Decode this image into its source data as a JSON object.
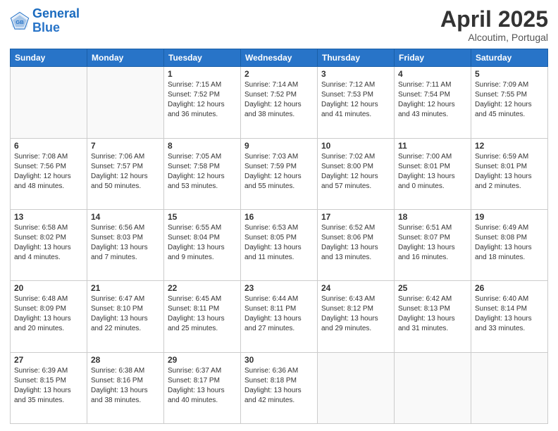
{
  "header": {
    "logo_line1": "General",
    "logo_line2": "Blue",
    "title": "April 2025",
    "subtitle": "Alcoutim, Portugal"
  },
  "days_of_week": [
    "Sunday",
    "Monday",
    "Tuesday",
    "Wednesday",
    "Thursday",
    "Friday",
    "Saturday"
  ],
  "weeks": [
    [
      {
        "day": "",
        "info": ""
      },
      {
        "day": "",
        "info": ""
      },
      {
        "day": "1",
        "info": "Sunrise: 7:15 AM\nSunset: 7:52 PM\nDaylight: 12 hours and 36 minutes."
      },
      {
        "day": "2",
        "info": "Sunrise: 7:14 AM\nSunset: 7:52 PM\nDaylight: 12 hours and 38 minutes."
      },
      {
        "day": "3",
        "info": "Sunrise: 7:12 AM\nSunset: 7:53 PM\nDaylight: 12 hours and 41 minutes."
      },
      {
        "day": "4",
        "info": "Sunrise: 7:11 AM\nSunset: 7:54 PM\nDaylight: 12 hours and 43 minutes."
      },
      {
        "day": "5",
        "info": "Sunrise: 7:09 AM\nSunset: 7:55 PM\nDaylight: 12 hours and 45 minutes."
      }
    ],
    [
      {
        "day": "6",
        "info": "Sunrise: 7:08 AM\nSunset: 7:56 PM\nDaylight: 12 hours and 48 minutes."
      },
      {
        "day": "7",
        "info": "Sunrise: 7:06 AM\nSunset: 7:57 PM\nDaylight: 12 hours and 50 minutes."
      },
      {
        "day": "8",
        "info": "Sunrise: 7:05 AM\nSunset: 7:58 PM\nDaylight: 12 hours and 53 minutes."
      },
      {
        "day": "9",
        "info": "Sunrise: 7:03 AM\nSunset: 7:59 PM\nDaylight: 12 hours and 55 minutes."
      },
      {
        "day": "10",
        "info": "Sunrise: 7:02 AM\nSunset: 8:00 PM\nDaylight: 12 hours and 57 minutes."
      },
      {
        "day": "11",
        "info": "Sunrise: 7:00 AM\nSunset: 8:01 PM\nDaylight: 13 hours and 0 minutes."
      },
      {
        "day": "12",
        "info": "Sunrise: 6:59 AM\nSunset: 8:01 PM\nDaylight: 13 hours and 2 minutes."
      }
    ],
    [
      {
        "day": "13",
        "info": "Sunrise: 6:58 AM\nSunset: 8:02 PM\nDaylight: 13 hours and 4 minutes."
      },
      {
        "day": "14",
        "info": "Sunrise: 6:56 AM\nSunset: 8:03 PM\nDaylight: 13 hours and 7 minutes."
      },
      {
        "day": "15",
        "info": "Sunrise: 6:55 AM\nSunset: 8:04 PM\nDaylight: 13 hours and 9 minutes."
      },
      {
        "day": "16",
        "info": "Sunrise: 6:53 AM\nSunset: 8:05 PM\nDaylight: 13 hours and 11 minutes."
      },
      {
        "day": "17",
        "info": "Sunrise: 6:52 AM\nSunset: 8:06 PM\nDaylight: 13 hours and 13 minutes."
      },
      {
        "day": "18",
        "info": "Sunrise: 6:51 AM\nSunset: 8:07 PM\nDaylight: 13 hours and 16 minutes."
      },
      {
        "day": "19",
        "info": "Sunrise: 6:49 AM\nSunset: 8:08 PM\nDaylight: 13 hours and 18 minutes."
      }
    ],
    [
      {
        "day": "20",
        "info": "Sunrise: 6:48 AM\nSunset: 8:09 PM\nDaylight: 13 hours and 20 minutes."
      },
      {
        "day": "21",
        "info": "Sunrise: 6:47 AM\nSunset: 8:10 PM\nDaylight: 13 hours and 22 minutes."
      },
      {
        "day": "22",
        "info": "Sunrise: 6:45 AM\nSunset: 8:11 PM\nDaylight: 13 hours and 25 minutes."
      },
      {
        "day": "23",
        "info": "Sunrise: 6:44 AM\nSunset: 8:11 PM\nDaylight: 13 hours and 27 minutes."
      },
      {
        "day": "24",
        "info": "Sunrise: 6:43 AM\nSunset: 8:12 PM\nDaylight: 13 hours and 29 minutes."
      },
      {
        "day": "25",
        "info": "Sunrise: 6:42 AM\nSunset: 8:13 PM\nDaylight: 13 hours and 31 minutes."
      },
      {
        "day": "26",
        "info": "Sunrise: 6:40 AM\nSunset: 8:14 PM\nDaylight: 13 hours and 33 minutes."
      }
    ],
    [
      {
        "day": "27",
        "info": "Sunrise: 6:39 AM\nSunset: 8:15 PM\nDaylight: 13 hours and 35 minutes."
      },
      {
        "day": "28",
        "info": "Sunrise: 6:38 AM\nSunset: 8:16 PM\nDaylight: 13 hours and 38 minutes."
      },
      {
        "day": "29",
        "info": "Sunrise: 6:37 AM\nSunset: 8:17 PM\nDaylight: 13 hours and 40 minutes."
      },
      {
        "day": "30",
        "info": "Sunrise: 6:36 AM\nSunset: 8:18 PM\nDaylight: 13 hours and 42 minutes."
      },
      {
        "day": "",
        "info": ""
      },
      {
        "day": "",
        "info": ""
      },
      {
        "day": "",
        "info": ""
      }
    ]
  ]
}
